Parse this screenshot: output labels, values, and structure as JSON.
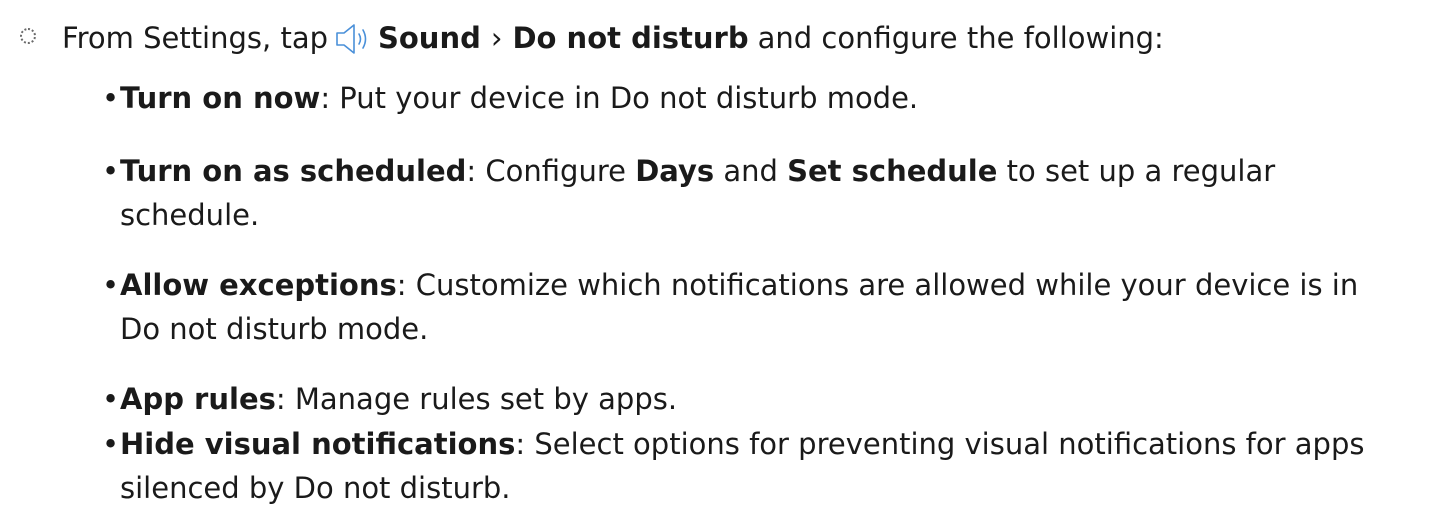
{
  "step": {
    "prefix": "From Settings, tap",
    "sound_label": "Sound",
    "separator": "›",
    "dnd_label": "Do not disturb",
    "suffix": "and configure the following:",
    "sound_icon": "speaker-icon"
  },
  "bullets": [
    {
      "term": "Turn on now",
      "colon": ":",
      "desc_parts": [
        " Put your device in Do not disturb mode."
      ]
    },
    {
      "term": "Turn on as scheduled",
      "colon": ":",
      "desc_a": " Configure ",
      "days": "Days",
      "desc_b": " and ",
      "set_schedule": "Set schedule",
      "desc_c": " to set up a regular schedule."
    },
    {
      "term": "Allow exceptions",
      "colon": ":",
      "desc": " Customize which notifications are allowed while your device is in Do not disturb mode."
    },
    {
      "term": "App rules",
      "colon": ":",
      "desc": " Manage rules set by apps."
    },
    {
      "term": "Hide visual notifications",
      "colon": ":",
      "desc": " Select options for preventing visual notifications for apps silenced by Do not disturb."
    }
  ],
  "bullet_char": "•"
}
